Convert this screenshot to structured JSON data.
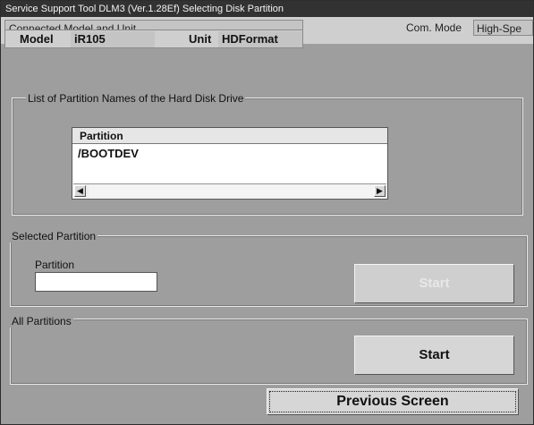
{
  "window": {
    "title": "Service Support Tool DLM3 (Ver.1.28Ef) Selecting Disk Partition"
  },
  "connection": {
    "section_label": "Connected Model and Unit",
    "com_mode_label": "Com. Mode",
    "com_mode_value": "High-Spe",
    "model_label": "Model",
    "model_value": "iR105",
    "unit_label": "Unit",
    "unit_value": "HDFormat"
  },
  "partition_list": {
    "group_label": "List of Partition Names of the Hard Disk Drive",
    "column_header": "Partition",
    "rows": [
      "/BOOTDEV"
    ],
    "scroll_left_icon": "left-arrow",
    "scroll_right_icon": "right-arrow"
  },
  "selected_partition": {
    "group_label": "Selected Partition",
    "field_label": "Partition",
    "field_value": "",
    "start_label": "Start",
    "start_enabled": false
  },
  "all_partitions": {
    "group_label": "All Partitions",
    "start_label": "Start"
  },
  "footer": {
    "previous_label": "Previous Screen"
  }
}
